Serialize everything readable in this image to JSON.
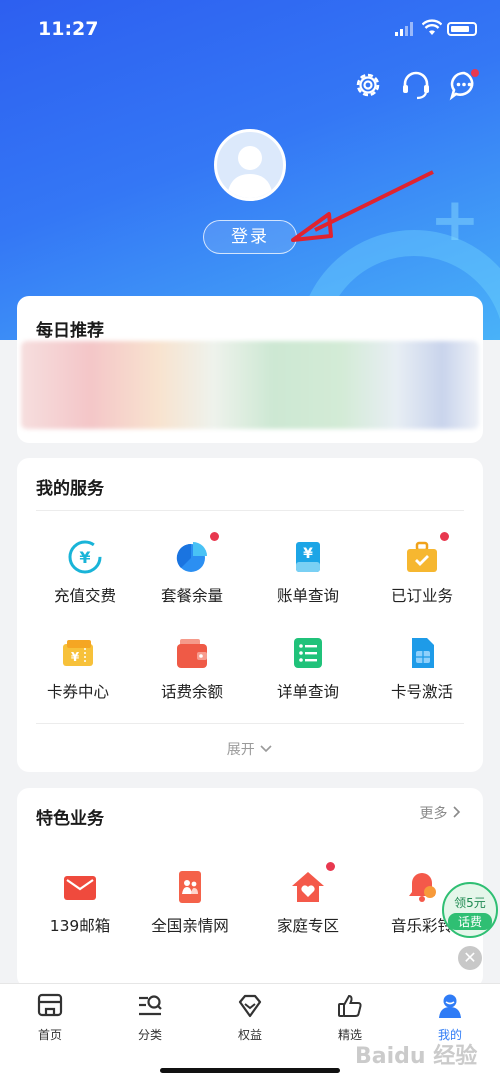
{
  "status_bar": {
    "time": "11:27"
  },
  "profile": {
    "login_label": "登录"
  },
  "daily": {
    "title": "每日推荐"
  },
  "services": {
    "title": "我的服务",
    "items": [
      {
        "label": "充值交费",
        "icon": "recharge-icon",
        "badge": false
      },
      {
        "label": "套餐余量",
        "icon": "pie-chart-icon",
        "badge": true
      },
      {
        "label": "账单查询",
        "icon": "bill-icon",
        "badge": false
      },
      {
        "label": "已订业务",
        "icon": "briefcase-icon",
        "badge": true
      },
      {
        "label": "卡券中心",
        "icon": "coupon-icon",
        "badge": false
      },
      {
        "label": "话费余额",
        "icon": "wallet-icon",
        "badge": false
      },
      {
        "label": "详单查询",
        "icon": "list-icon",
        "badge": false
      },
      {
        "label": "卡号激活",
        "icon": "sim-card-icon",
        "badge": false
      }
    ],
    "expand_label": "展开"
  },
  "featured": {
    "title": "特色业务",
    "more_label": "更多",
    "items": [
      {
        "label": "139邮箱",
        "icon": "mail-icon",
        "badge": false
      },
      {
        "label": "全国亲情网",
        "icon": "family-phone-icon",
        "badge": false
      },
      {
        "label": "家庭专区",
        "icon": "home-heart-icon",
        "badge": true
      },
      {
        "label": "音乐彩铃",
        "icon": "bell-icon",
        "badge": false
      }
    ]
  },
  "float_promo": {
    "line1": "领5元",
    "line2": "话费"
  },
  "tabbar": {
    "tabs": [
      {
        "label": "首页",
        "icon": "home-icon",
        "active": false
      },
      {
        "label": "分类",
        "icon": "category-search-icon",
        "active": false
      },
      {
        "label": "权益",
        "icon": "diamond-icon",
        "active": false
      },
      {
        "label": "精选",
        "icon": "thumbs-up-icon",
        "active": false
      },
      {
        "label": "我的",
        "icon": "user-icon",
        "active": true
      }
    ]
  },
  "colors": {
    "primary": "#3477f5",
    "active_tab": "#2f7cf6",
    "badge": "#e8384f",
    "promo_green": "#2fbf73"
  },
  "watermark": "Baidu 经验"
}
